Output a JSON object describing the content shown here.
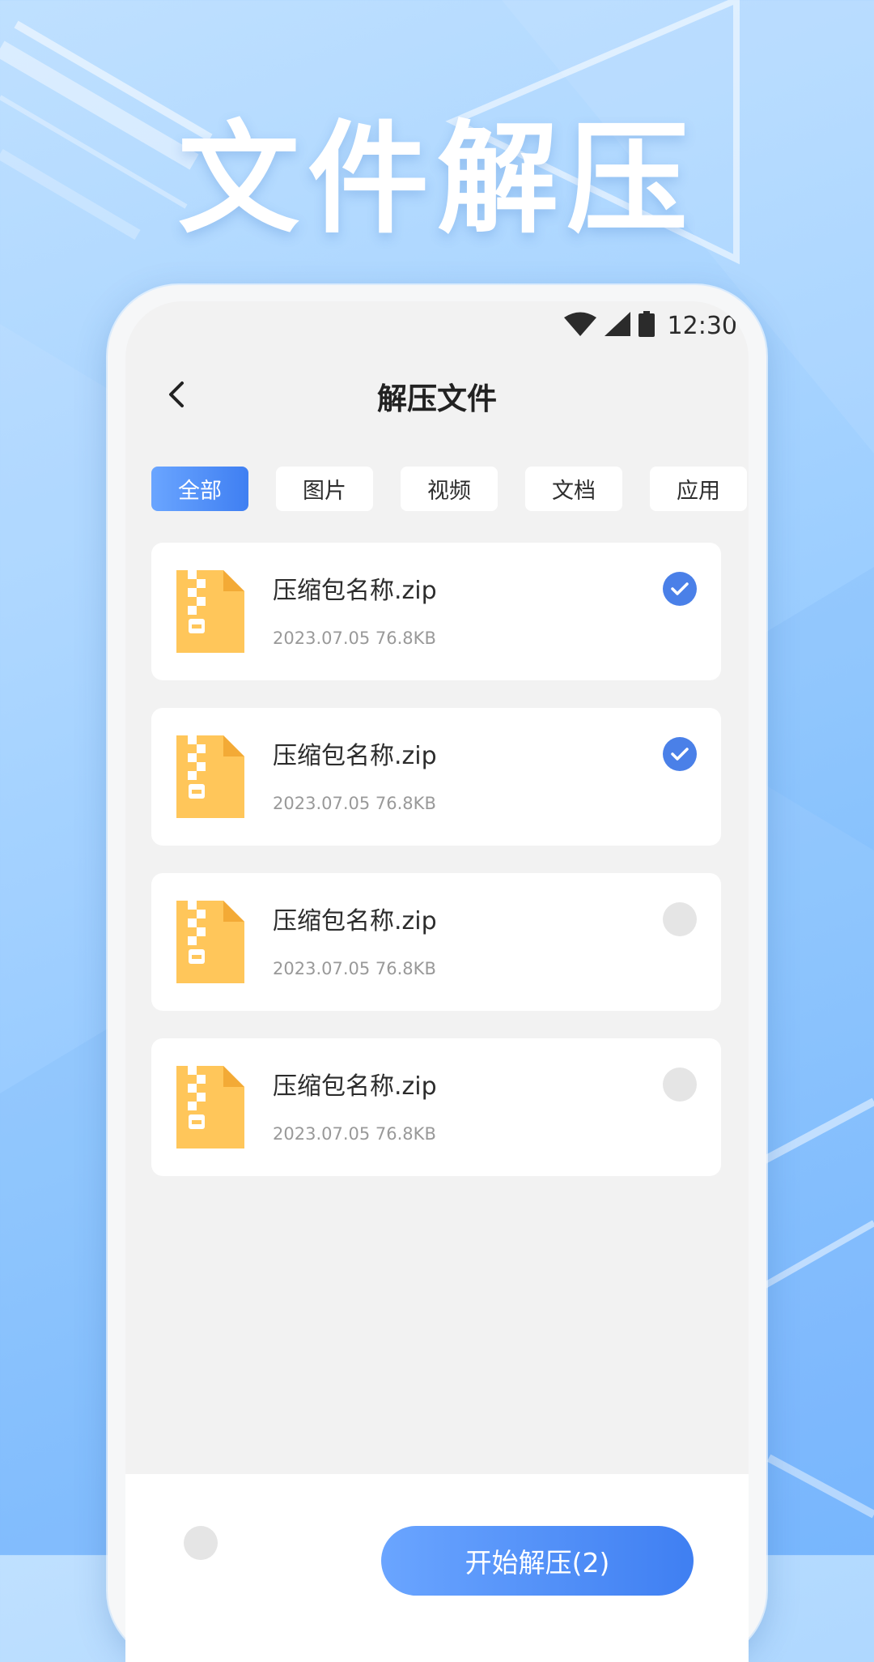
{
  "promo": {
    "title": "文件解压"
  },
  "status_bar": {
    "time": "12:30",
    "icons": [
      "wifi-icon",
      "signal-icon",
      "battery-icon"
    ]
  },
  "nav": {
    "back_icon": "chevron-left-icon",
    "title": "解压文件"
  },
  "tabs": [
    {
      "label": "全部",
      "active": true
    },
    {
      "label": "图片",
      "active": false
    },
    {
      "label": "视频",
      "active": false
    },
    {
      "label": "文档",
      "active": false
    },
    {
      "label": "应用",
      "active": false
    }
  ],
  "files": [
    {
      "name": "压缩包名称.zip",
      "meta": "2023.07.05 76.8KB",
      "checked": true,
      "icon": "zip-file-icon"
    },
    {
      "name": "压缩包名称.zip",
      "meta": "2023.07.05 76.8KB",
      "checked": true,
      "icon": "zip-file-icon"
    },
    {
      "name": "压缩包名称.zip",
      "meta": "2023.07.05 76.8KB",
      "checked": false,
      "icon": "zip-file-icon"
    },
    {
      "name": "压缩包名称.zip",
      "meta": "2023.07.05 76.8KB",
      "checked": false,
      "icon": "zip-file-icon"
    }
  ],
  "bottom": {
    "select_all_checked": false,
    "action_label": "开始解压(2)"
  },
  "colors": {
    "accent": "#4a80e8",
    "accent_gradient_start": "#6aa5ff",
    "file_icon": "#ffc65a",
    "background": "#f2f2f2"
  }
}
